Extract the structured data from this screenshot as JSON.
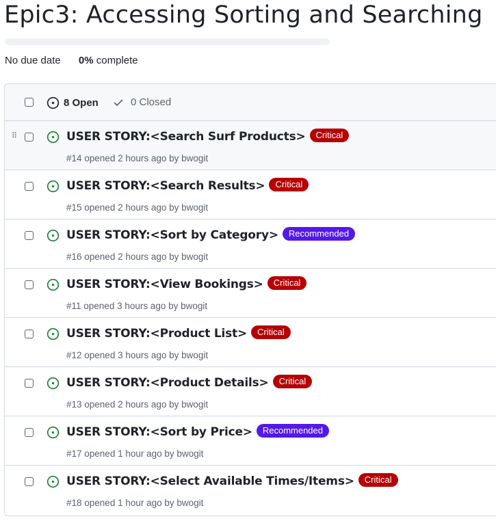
{
  "milestone": {
    "title": "Epic3: Accessing Sorting and Searching",
    "due": "No due date",
    "percent": "0%",
    "percent_suffix": "complete",
    "progress": 0
  },
  "header": {
    "open_label": "8 Open",
    "closed_label": "0 Closed"
  },
  "colors": {
    "critical": "#b60205",
    "recommended": "#5319e7",
    "open_green": "#1a7f37"
  },
  "issues": [
    {
      "title": "USER STORY:<Search Surf Products>",
      "label": "Critical",
      "label_type": "critical",
      "meta": "#14 opened 2 hours ago by bwogit"
    },
    {
      "title": "USER STORY:<Search Results>",
      "label": "Critical",
      "label_type": "critical",
      "meta": "#15 opened 2 hours ago by bwogit"
    },
    {
      "title": "USER STORY:<Sort by Category>",
      "label": "Recommended",
      "label_type": "recommended",
      "meta": "#16 opened 2 hours ago by bwogit"
    },
    {
      "title": "USER STORY:<View Bookings>",
      "label": "Critical",
      "label_type": "critical",
      "meta": "#11 opened 3 hours ago by bwogit"
    },
    {
      "title": "USER STORY:<Product List>",
      "label": "Critical",
      "label_type": "critical",
      "meta": "#12 opened 3 hours ago by bwogit"
    },
    {
      "title": "USER STORY:<Product Details>",
      "label": "Critical",
      "label_type": "critical",
      "meta": "#13 opened 2 hours ago by bwogit"
    },
    {
      "title": "USER STORY:<Sort by Price>",
      "label": "Recommended",
      "label_type": "recommended",
      "meta": "#17 opened 1 hour ago by bwogit"
    },
    {
      "title": "USER STORY:<Select Available Times/Items>",
      "label": "Critical",
      "label_type": "critical",
      "meta": "#18 opened 1 hour ago by bwogit"
    }
  ]
}
